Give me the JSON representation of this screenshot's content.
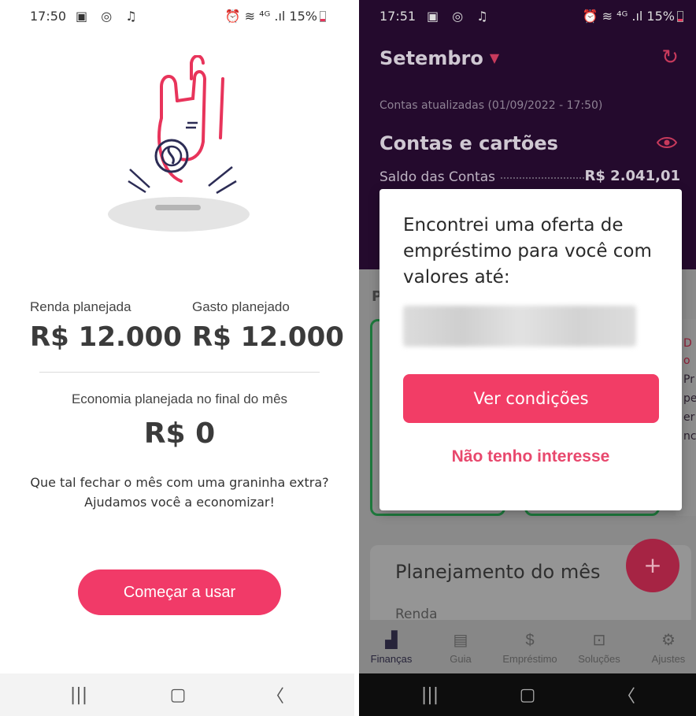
{
  "left": {
    "status": {
      "time": "17:50",
      "icons": "▣ ◎ ♫",
      "right": "⏰ ≋ ⁴ᴳ .ıl 15%"
    },
    "renda_label": "Renda planejada",
    "renda_value": "R$ 12.000",
    "gasto_label": "Gasto planejado",
    "gasto_value": "R$ 12.000",
    "economia_label": "Economia planejada no final do mês",
    "economia_value": "R$ 0",
    "message_line1": "Que tal fechar o mês com uma graninha extra?",
    "message_line2": "Ajudamos você a economizar!",
    "start_button": "Começar a usar",
    "nav": {
      "recents": "|||",
      "home": "▢",
      "back": "〈"
    }
  },
  "right": {
    "status": {
      "time": "17:51",
      "icons": "▣ ◎ ♫",
      "right": "⏰ ≋ ⁴ᴳ .ıl 15%"
    },
    "month": "Setembro",
    "updated": "Contas atualizadas  (01/09/2022 - 17:50)",
    "contas_title": "Contas e cartões",
    "saldo_label": "Saldo das Contas",
    "saldo_value": "R$ 2.041,01",
    "p_letter": "P",
    "side_texts": [
      "D",
      "o",
      "Pr",
      "pe",
      "er",
      "nc"
    ],
    "plan_title": "Planejamento do mês",
    "renda_label": "Renda",
    "fab": "+",
    "modal": {
      "title": "Encontrei uma oferta de empréstimo para você com valores até:",
      "primary_button": "Ver condições",
      "secondary_button": "Não tenho interesse"
    },
    "tabs": [
      {
        "label": "Finanças",
        "icon": "finance-chart-icon",
        "active": true
      },
      {
        "label": "Guia",
        "icon": "guide-icon",
        "active": false
      },
      {
        "label": "Empréstimo",
        "icon": "loan-hand-icon",
        "active": false
      },
      {
        "label": "Soluções",
        "icon": "bag-icon",
        "active": false
      },
      {
        "label": "Ajustes",
        "icon": "gear-icon",
        "active": false
      }
    ],
    "nav": {
      "recents": "|||",
      "home": "▢",
      "back": "〈"
    }
  },
  "colors": {
    "brand_pink": "#f13a68",
    "header_dark": "#240a2d",
    "dim_overlay": "#8a8a8a"
  }
}
